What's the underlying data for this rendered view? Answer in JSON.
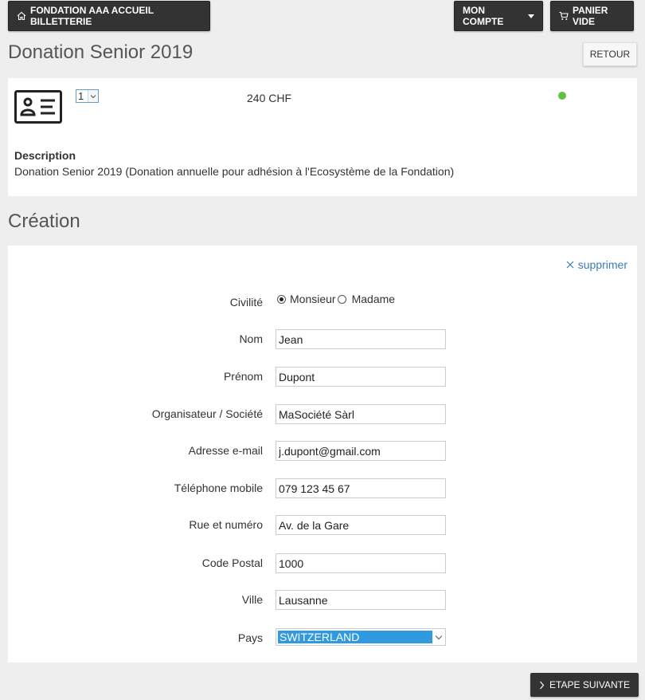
{
  "header": {
    "home_label": "FONDATION AAA ACCUEIL BILLETTERIE",
    "account_label": "MON COMPTE",
    "cart_label": "PANIER VIDE"
  },
  "page": {
    "title": "Donation Senior 2019",
    "back_label": "RETOUR"
  },
  "product": {
    "quantity": "1",
    "price": "240 CHF",
    "status_color": "#5cc23f",
    "description_label": "Description",
    "description": "Donation Senior 2019 (Donation annuelle pour adhésion à l'Ecosystème de la Fondation)"
  },
  "form": {
    "section_title": "Création",
    "delete_label": "supprimer",
    "civility": {
      "label": "Civilité",
      "options": [
        "Monsieur",
        "Madame"
      ],
      "selected": "Monsieur"
    },
    "fields": {
      "nom": {
        "label": "Nom",
        "value": "Jean"
      },
      "prenom": {
        "label": "Prénom",
        "value": "Dupont"
      },
      "societe": {
        "label": "Organisateur / Société",
        "value": "MaSociété Sàrl"
      },
      "email": {
        "label": "Adresse e-mail",
        "value": "j.dupont@gmail.com"
      },
      "mobile": {
        "label": "Téléphone mobile",
        "value": "079 123 45 67"
      },
      "rue": {
        "label": "Rue et numéro",
        "value": "Av. de la Gare"
      },
      "npa": {
        "label": "Code Postal",
        "value": "1000"
      },
      "ville": {
        "label": "Ville",
        "value": "Lausanne"
      },
      "pays": {
        "label": "Pays",
        "value": "SWITZERLAND"
      }
    }
  },
  "footer": {
    "next_label": "ETAPE SUIVANTE"
  },
  "colors": {
    "dark_button": "#333333",
    "link": "#3a7ab8",
    "select_highlight": "#2f9ae0",
    "background": "#eeeeee"
  }
}
